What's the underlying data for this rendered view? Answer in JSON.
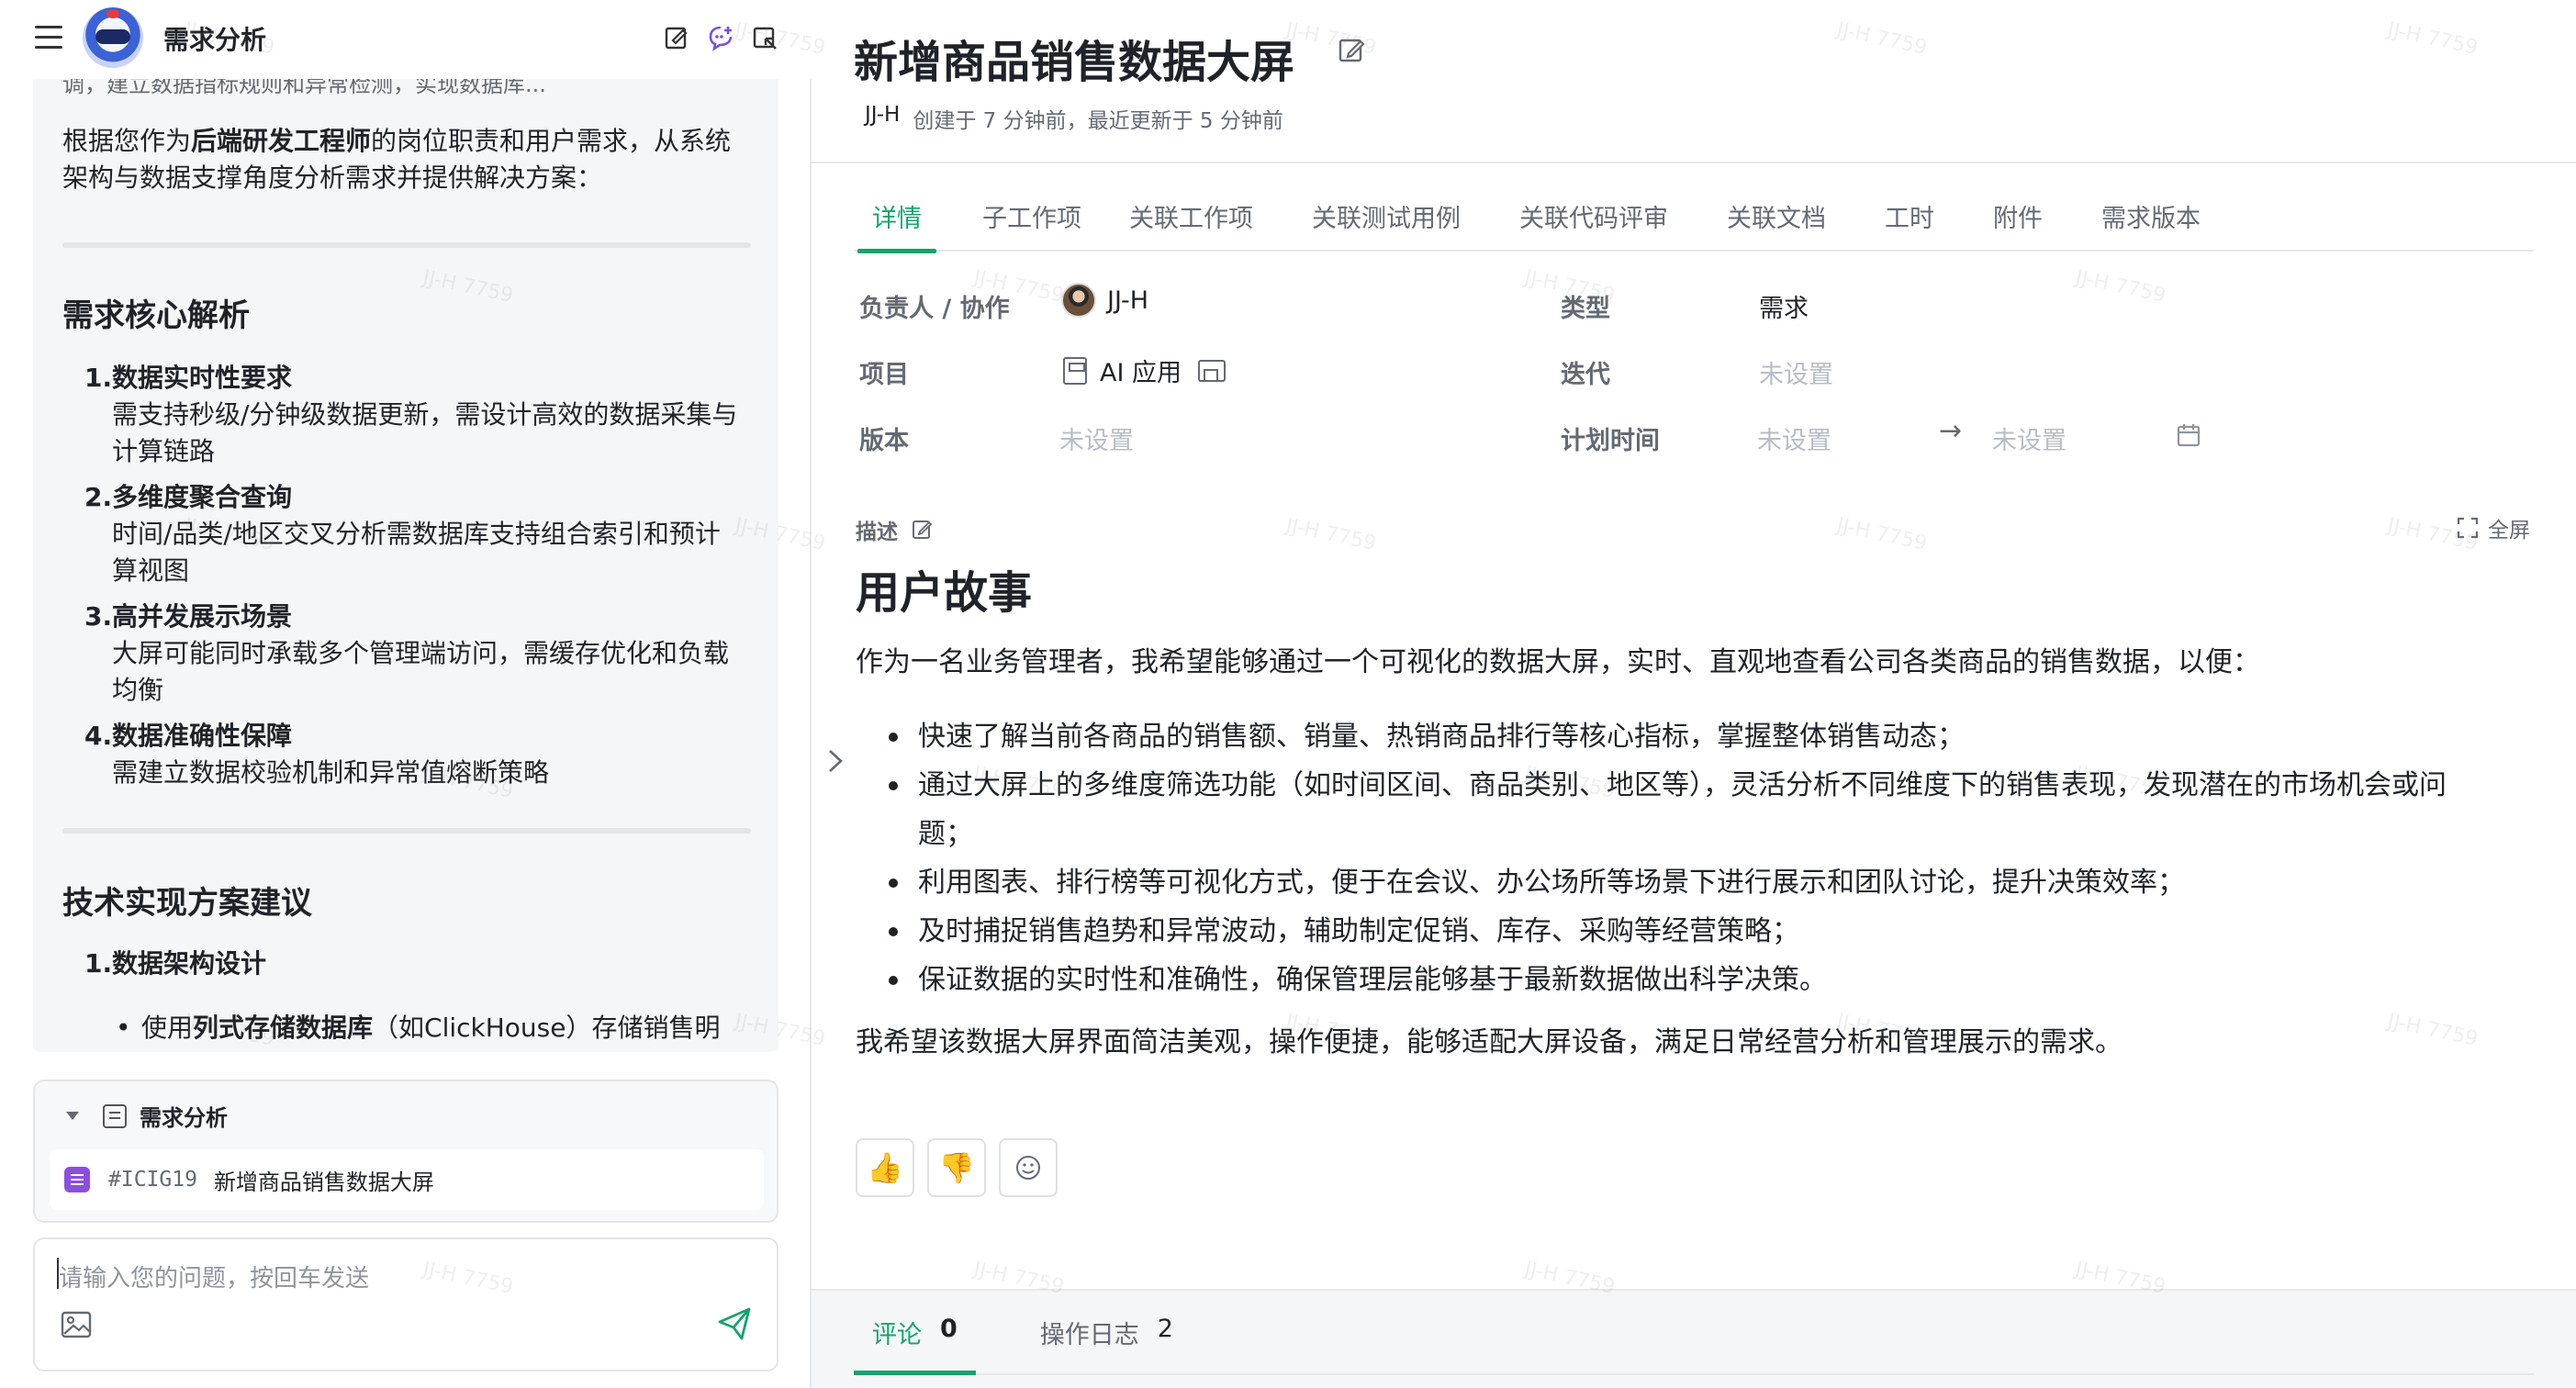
{
  "left_panel": {
    "title": "需求分析",
    "cut_line": "调，建立数据指标规则和异常检测，实现数据库...",
    "intro_prefix": "根据您作为",
    "intro_role": "后端研发工程师",
    "intro_suffix": "的岗位职责和用户需求，从系统架构与数据支撑角度分析需求并提供解决方案：",
    "section1_title": "需求核心解析",
    "section1_items": [
      {
        "num": "1.",
        "title": "数据实时性要求",
        "desc": "需支持秒级/分钟级数据更新，需设计高效的数据采集与计算链路"
      },
      {
        "num": "2.",
        "title": "多维度聚合查询",
        "desc": "时间/品类/地区交叉分析需数据库支持组合索引和预计算视图"
      },
      {
        "num": "3.",
        "title": "高并发展示场景",
        "desc": "大屏可能同时承载多个管理端访问，需缓存优化和负载均衡"
      },
      {
        "num": "4.",
        "title": "数据准确性保障",
        "desc": "需建立数据校验机制和异常值熔断策略"
      }
    ],
    "section2_title": "技术实现方案建议",
    "section2_items": [
      {
        "num": "1.",
        "title": "数据架构设计"
      }
    ],
    "sub_bullet_prefix": "使用",
    "sub_bullet_bold": "列式存储数据库",
    "sub_bullet_suffix": "（如ClickHouse）存储销售明",
    "ref_card": {
      "title": "需求分析",
      "item_code": "#ICIG19",
      "item_name": "新增商品销售数据大屏"
    },
    "input_placeholder": "请输入您的问题，按回车发送"
  },
  "detail": {
    "title": "新增商品销售数据大屏",
    "author": "JJ-H",
    "meta_text": "创建于 7 分钟前，最近更新于 5 分钟前",
    "tabs": [
      "详情",
      "子工作项",
      "关联工作项",
      "关联测试用例",
      "关联代码评审",
      "关联文档",
      "工时",
      "附件",
      "需求版本"
    ],
    "active_tab": "详情",
    "fields": {
      "assignee_label": "负责人 / 协作",
      "assignee_value": "JJ-H",
      "type_label": "类型",
      "type_value": "需求",
      "project_label": "项目",
      "project_value": "AI 应用",
      "iteration_label": "迭代",
      "iteration_value": "未设置",
      "version_label": "版本",
      "version_value": "未设置",
      "plan_label": "计划时间",
      "plan_start": "未设置",
      "plan_end": "未设置"
    },
    "desc_label": "描述",
    "fullscreen_label": "全屏",
    "desc_heading": "用户故事",
    "desc_intro": "作为一名业务管理者，我希望能够通过一个可视化的数据大屏，实时、直观地查看公司各类商品的销售数据，以便：",
    "desc_bullets": [
      "快速了解当前各商品的销售额、销量、热销商品排行等核心指标，掌握整体销售动态；",
      "通过大屏上的多维度筛选功能（如时间区间、商品类别、地区等），灵活分析不同维度下的销售表现，发现潜在的市场机会或问题；",
      "利用图表、排行榜等可视化方式，便于在会议、办公场所等场景下进行展示和团队讨论，提升决策效率；",
      "及时捕捉销售趋势和异常波动，辅助制定促销、库存、采购等经营策略；",
      "保证数据的实时性和准确性，确保管理层能够基于最新数据做出科学决策。"
    ],
    "desc_closing": "我希望该数据大屏界面简洁美观，操作便捷，能够适配大屏设备，满足日常经营分析和管理展示的需求。",
    "bottom_tabs": [
      {
        "label": "评论",
        "count": "0"
      },
      {
        "label": "操作日志",
        "count": "2"
      }
    ]
  },
  "watermark": "JJ-H 7759",
  "colors": {
    "accent": "#13a46c",
    "badge_purple": "#8a4fdc"
  }
}
